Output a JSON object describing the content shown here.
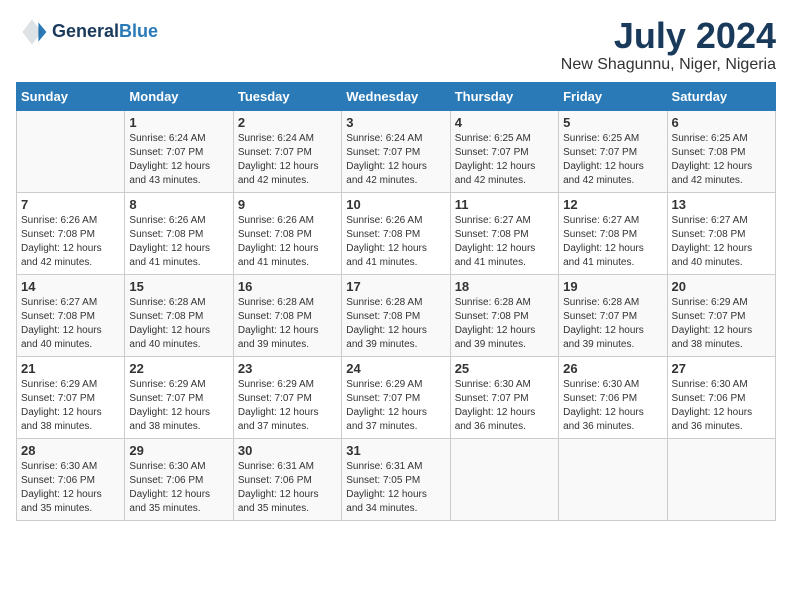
{
  "header": {
    "logo_line1": "General",
    "logo_line2": "Blue",
    "month_year": "July 2024",
    "location": "New Shagunnu, Niger, Nigeria"
  },
  "weekdays": [
    "Sunday",
    "Monday",
    "Tuesday",
    "Wednesday",
    "Thursday",
    "Friday",
    "Saturday"
  ],
  "weeks": [
    [
      {
        "day": "",
        "sunrise": "",
        "sunset": "",
        "daylight": ""
      },
      {
        "day": "1",
        "sunrise": "6:24 AM",
        "sunset": "7:07 PM",
        "daylight": "12 hours and 43 minutes."
      },
      {
        "day": "2",
        "sunrise": "6:24 AM",
        "sunset": "7:07 PM",
        "daylight": "12 hours and 42 minutes."
      },
      {
        "day": "3",
        "sunrise": "6:24 AM",
        "sunset": "7:07 PM",
        "daylight": "12 hours and 42 minutes."
      },
      {
        "day": "4",
        "sunrise": "6:25 AM",
        "sunset": "7:07 PM",
        "daylight": "12 hours and 42 minutes."
      },
      {
        "day": "5",
        "sunrise": "6:25 AM",
        "sunset": "7:07 PM",
        "daylight": "12 hours and 42 minutes."
      },
      {
        "day": "6",
        "sunrise": "6:25 AM",
        "sunset": "7:08 PM",
        "daylight": "12 hours and 42 minutes."
      }
    ],
    [
      {
        "day": "7",
        "sunrise": "6:26 AM",
        "sunset": "7:08 PM",
        "daylight": "12 hours and 42 minutes."
      },
      {
        "day": "8",
        "sunrise": "6:26 AM",
        "sunset": "7:08 PM",
        "daylight": "12 hours and 41 minutes."
      },
      {
        "day": "9",
        "sunrise": "6:26 AM",
        "sunset": "7:08 PM",
        "daylight": "12 hours and 41 minutes."
      },
      {
        "day": "10",
        "sunrise": "6:26 AM",
        "sunset": "7:08 PM",
        "daylight": "12 hours and 41 minutes."
      },
      {
        "day": "11",
        "sunrise": "6:27 AM",
        "sunset": "7:08 PM",
        "daylight": "12 hours and 41 minutes."
      },
      {
        "day": "12",
        "sunrise": "6:27 AM",
        "sunset": "7:08 PM",
        "daylight": "12 hours and 41 minutes."
      },
      {
        "day": "13",
        "sunrise": "6:27 AM",
        "sunset": "7:08 PM",
        "daylight": "12 hours and 40 minutes."
      }
    ],
    [
      {
        "day": "14",
        "sunrise": "6:27 AM",
        "sunset": "7:08 PM",
        "daylight": "12 hours and 40 minutes."
      },
      {
        "day": "15",
        "sunrise": "6:28 AM",
        "sunset": "7:08 PM",
        "daylight": "12 hours and 40 minutes."
      },
      {
        "day": "16",
        "sunrise": "6:28 AM",
        "sunset": "7:08 PM",
        "daylight": "12 hours and 39 minutes."
      },
      {
        "day": "17",
        "sunrise": "6:28 AM",
        "sunset": "7:08 PM",
        "daylight": "12 hours and 39 minutes."
      },
      {
        "day": "18",
        "sunrise": "6:28 AM",
        "sunset": "7:08 PM",
        "daylight": "12 hours and 39 minutes."
      },
      {
        "day": "19",
        "sunrise": "6:28 AM",
        "sunset": "7:07 PM",
        "daylight": "12 hours and 39 minutes."
      },
      {
        "day": "20",
        "sunrise": "6:29 AM",
        "sunset": "7:07 PM",
        "daylight": "12 hours and 38 minutes."
      }
    ],
    [
      {
        "day": "21",
        "sunrise": "6:29 AM",
        "sunset": "7:07 PM",
        "daylight": "12 hours and 38 minutes."
      },
      {
        "day": "22",
        "sunrise": "6:29 AM",
        "sunset": "7:07 PM",
        "daylight": "12 hours and 38 minutes."
      },
      {
        "day": "23",
        "sunrise": "6:29 AM",
        "sunset": "7:07 PM",
        "daylight": "12 hours and 37 minutes."
      },
      {
        "day": "24",
        "sunrise": "6:29 AM",
        "sunset": "7:07 PM",
        "daylight": "12 hours and 37 minutes."
      },
      {
        "day": "25",
        "sunrise": "6:30 AM",
        "sunset": "7:07 PM",
        "daylight": "12 hours and 36 minutes."
      },
      {
        "day": "26",
        "sunrise": "6:30 AM",
        "sunset": "7:06 PM",
        "daylight": "12 hours and 36 minutes."
      },
      {
        "day": "27",
        "sunrise": "6:30 AM",
        "sunset": "7:06 PM",
        "daylight": "12 hours and 36 minutes."
      }
    ],
    [
      {
        "day": "28",
        "sunrise": "6:30 AM",
        "sunset": "7:06 PM",
        "daylight": "12 hours and 35 minutes."
      },
      {
        "day": "29",
        "sunrise": "6:30 AM",
        "sunset": "7:06 PM",
        "daylight": "12 hours and 35 minutes."
      },
      {
        "day": "30",
        "sunrise": "6:31 AM",
        "sunset": "7:06 PM",
        "daylight": "12 hours and 35 minutes."
      },
      {
        "day": "31",
        "sunrise": "6:31 AM",
        "sunset": "7:05 PM",
        "daylight": "12 hours and 34 minutes."
      },
      {
        "day": "",
        "sunrise": "",
        "sunset": "",
        "daylight": ""
      },
      {
        "day": "",
        "sunrise": "",
        "sunset": "",
        "daylight": ""
      },
      {
        "day": "",
        "sunrise": "",
        "sunset": "",
        "daylight": ""
      }
    ]
  ]
}
